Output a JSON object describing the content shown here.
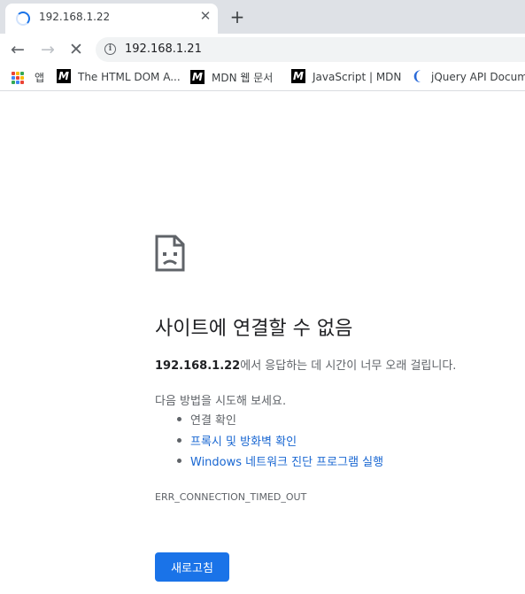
{
  "tab": {
    "title": "192.168.1.22",
    "close_glyph": "✕",
    "new_tab_glyph": "+"
  },
  "toolbar": {
    "back_glyph": "←",
    "forward_glyph": "→",
    "stop_glyph": "✕",
    "url": "192.168.1.21",
    "info_glyph": "i"
  },
  "bookmarks": {
    "apps_label": "앱",
    "items": [
      {
        "label": "The HTML DOM A...",
        "icon": "mdn-icon"
      },
      {
        "label": "MDN 웹 문서",
        "icon": "mdn-icon"
      },
      {
        "label": "JavaScript | MDN",
        "icon": "mdn-icon"
      },
      {
        "label": "jQuery API Docum...",
        "icon": "jquery-icon"
      }
    ],
    "mdn_glyph": "M",
    "jquery_glyph": "❨"
  },
  "error_page": {
    "icon": "sad-document-icon",
    "heading": "사이트에 연결할 수 없음",
    "host": "192.168.1.22",
    "description_suffix": "에서 응답하는 데 시간이 너무 오래 걸립니다.",
    "try_label": "다음 방법을 시도해 보세요.",
    "suggestions": [
      {
        "label": "연결 확인",
        "link": false
      },
      {
        "label": "프록시 및 방화벽 확인",
        "link": true
      },
      {
        "label": "Windows 네트워크 진단 프로그램 실행",
        "link": true
      }
    ],
    "error_code": "ERR_CONNECTION_TIMED_OUT",
    "reload_label": "새로고침"
  },
  "colors": {
    "accent": "#1a73e8",
    "link": "#1967d2",
    "tabstrip": "#dee1e6",
    "omnibox": "#f1f3f4",
    "apps_grid": [
      "#ea4335",
      "#fbbc04",
      "#34a853",
      "#4285f4",
      "#ea4335",
      "#fbbc04",
      "#34a853",
      "#4285f4",
      "#ea4335"
    ]
  }
}
